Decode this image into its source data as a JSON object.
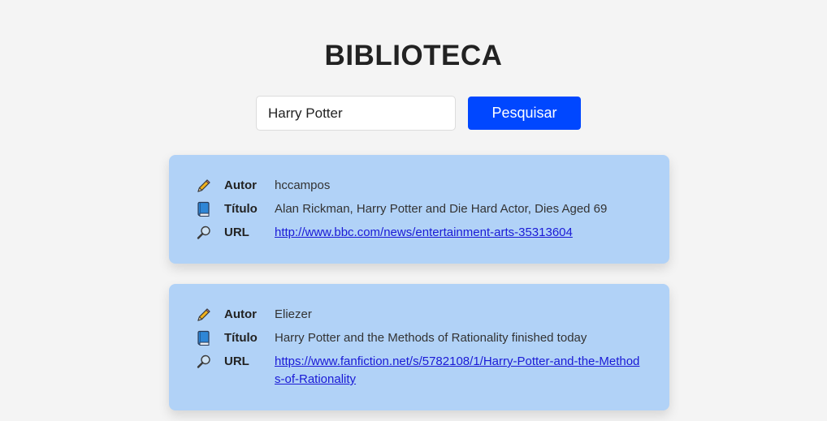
{
  "header": {
    "title": "BIBLIOTECA"
  },
  "search": {
    "value": "Harry Potter",
    "button_label": "Pesquisar"
  },
  "colors": {
    "background": "#f4f4f4",
    "card": "#b1d2f7",
    "button": "#0047ff",
    "link": "#1a1ad6"
  },
  "results": [
    {
      "author_label": "Autor",
      "author": "hccampos",
      "title_label": "Título",
      "title": "Alan Rickman, Harry Potter and Die Hard Actor, Dies Aged 69",
      "url_label": "URL",
      "url": "http://www.bbc.com/news/entertainment-arts-35313604",
      "icons": [
        "pencil-icon",
        "book-icon",
        "magnifier-icon"
      ]
    },
    {
      "author_label": "Autor",
      "author": "Eliezer",
      "title_label": "Título",
      "title": "Harry Potter and the Methods of Rationality finished today",
      "url_label": "URL",
      "url": "https://www.fanfiction.net/s/5782108/1/Harry-Potter-and-the-Methods-of-Rationality",
      "icons": [
        "pencil-icon",
        "book-icon",
        "magnifier-icon"
      ]
    }
  ]
}
